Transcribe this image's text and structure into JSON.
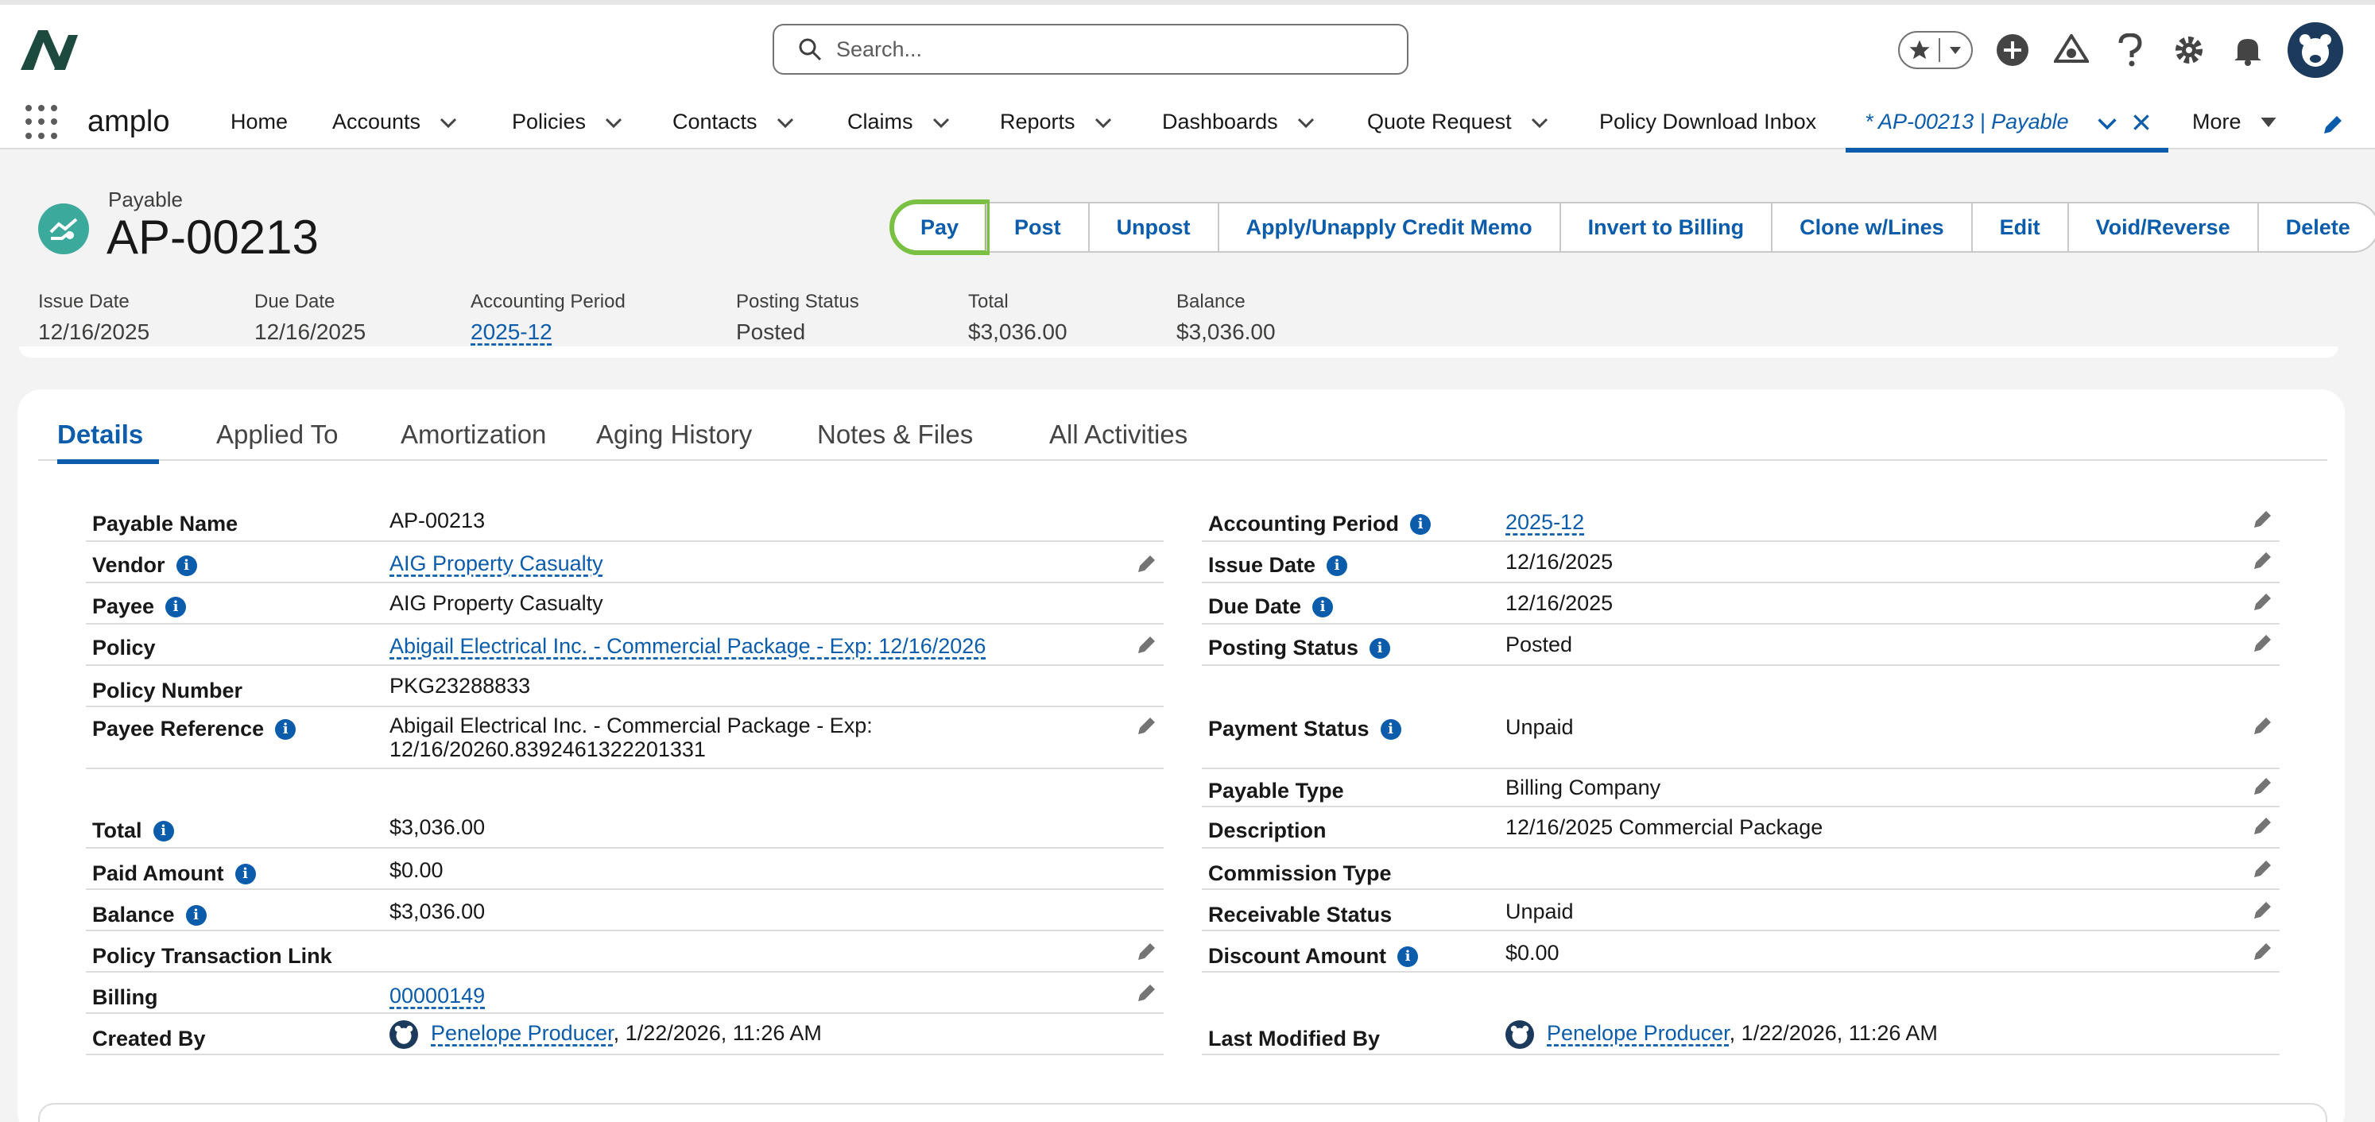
{
  "app": {
    "name": "amplo"
  },
  "search": {
    "placeholder": "Search..."
  },
  "nav": {
    "items": [
      "Home",
      "Accounts",
      "Policies",
      "Contacts",
      "Claims",
      "Reports",
      "Dashboards",
      "Quote Request",
      "Policy Download Inbox"
    ],
    "active_tab": "* AP-00213 | Payable",
    "more": "More"
  },
  "record": {
    "type": "Payable",
    "title": "AP-00213",
    "actions": [
      "Pay",
      "Post",
      "Unpost",
      "Apply/Unapply Credit Memo",
      "Invert to Billing",
      "Clone w/Lines",
      "Edit",
      "Void/Reverse",
      "Delete"
    ],
    "highlights": [
      {
        "label": "Issue Date",
        "value": "12/16/2025"
      },
      {
        "label": "Due Date",
        "value": "12/16/2025"
      },
      {
        "label": "Accounting Period",
        "value": "2025-12"
      },
      {
        "label": "Posting Status",
        "value": "Posted"
      },
      {
        "label": "Total",
        "value": "$3,036.00"
      },
      {
        "label": "Balance",
        "value": "$3,036.00"
      }
    ]
  },
  "tabs": [
    "Details",
    "Applied To",
    "Amortization",
    "Aging History",
    "Notes & Files",
    "All Activities"
  ],
  "details": {
    "left": {
      "payable_name": {
        "label": "Payable Name",
        "value": "AP-00213"
      },
      "vendor": {
        "label": "Vendor",
        "value": "AIG Property Casualty"
      },
      "payee": {
        "label": "Payee",
        "value": "AIG Property Casualty"
      },
      "policy": {
        "label": "Policy",
        "value": "Abigail Electrical Inc. - Commercial Package - Exp: 12/16/2026"
      },
      "policy_number": {
        "label": "Policy Number",
        "value": "PKG23288833"
      },
      "payee_reference": {
        "label": "Payee Reference",
        "value_line1": "Abigail Electrical Inc. - Commercial Package - Exp:",
        "value_line2": "12/16/20260.8392461322201331"
      },
      "total": {
        "label": "Total",
        "value": "$3,036.00"
      },
      "paid_amount": {
        "label": "Paid Amount",
        "value": "$0.00"
      },
      "balance": {
        "label": "Balance",
        "value": "$3,036.00"
      },
      "policy_transaction_link": {
        "label": "Policy Transaction Link",
        "value": ""
      },
      "billing": {
        "label": "Billing",
        "value": "00000149"
      },
      "created_by": {
        "label": "Created By",
        "user": "Penelope Producer",
        "date": ", 1/22/2026, 11:26 AM"
      }
    },
    "right": {
      "accounting_period": {
        "label": "Accounting Period",
        "value": "2025-12"
      },
      "issue_date": {
        "label": "Issue Date",
        "value": "12/16/2025"
      },
      "due_date": {
        "label": "Due Date",
        "value": "12/16/2025"
      },
      "posting_status": {
        "label": "Posting Status",
        "value": "Posted"
      },
      "payment_status": {
        "label": "Payment Status",
        "value": "Unpaid"
      },
      "payable_type": {
        "label": "Payable Type",
        "value": "Billing Company"
      },
      "description": {
        "label": "Description",
        "value": "12/16/2025 Commercial Package"
      },
      "commission_type": {
        "label": "Commission Type",
        "value": ""
      },
      "receivable_status": {
        "label": "Receivable Status",
        "value": "Unpaid"
      },
      "discount_amount": {
        "label": "Discount Amount",
        "value": "$0.00"
      },
      "last_modified_by": {
        "label": "Last Modified By",
        "user": "Penelope Producer",
        "date": ", 1/22/2026, 11:26 AM"
      }
    }
  },
  "colors": {
    "brand": "#0b5cab",
    "highlight": "#7ac043",
    "record_icon": "#3ba99c"
  },
  "icons": [
    "logo-icon",
    "search-icon",
    "star-icon",
    "add-icon",
    "trailhead-icon",
    "help-icon",
    "gear-icon",
    "bell-icon",
    "avatar-icon",
    "waffle-icon",
    "chevron-down-icon",
    "close-icon",
    "pencil-icon",
    "info-icon",
    "payable-icon"
  ]
}
